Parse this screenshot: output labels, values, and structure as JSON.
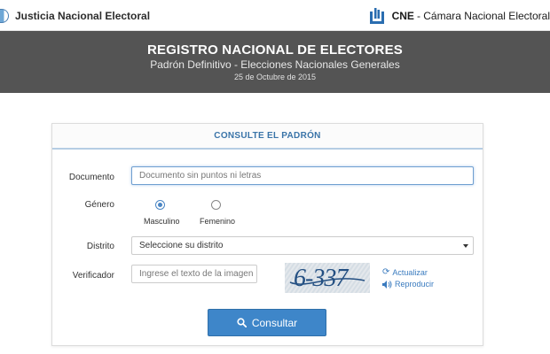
{
  "header": {
    "left_title": "Justicia Nacional Electoral",
    "right_code": "CNE",
    "right_name": "- Cámara Nacional Electoral"
  },
  "banner": {
    "title": "REGISTRO NACIONAL DE ELECTORES",
    "subtitle": "Padrón Definitivo - Elecciones Nacionales Generales",
    "date": "25 de Octubre de 2015"
  },
  "form": {
    "title": "CONSULTE EL PADRÓN",
    "documento": {
      "label": "Documento",
      "placeholder": "Documento sin puntos ni letras",
      "value": ""
    },
    "genero": {
      "label": "Género",
      "options": [
        "Masculino",
        "Femenino"
      ],
      "selected": "Masculino"
    },
    "distrito": {
      "label": "Distrito",
      "selected": "Seleccione su distrito"
    },
    "verificador": {
      "label": "Verificador",
      "placeholder": "Ingrese el texto de la imagen",
      "captcha_text": "6-337",
      "refresh_label": "Actualizar",
      "play_label": "Reproducir"
    },
    "submit_label": "Consultar"
  },
  "colors": {
    "banner_bg": "#545454",
    "accent": "#3e86c9",
    "link": "#3a7bbf"
  }
}
